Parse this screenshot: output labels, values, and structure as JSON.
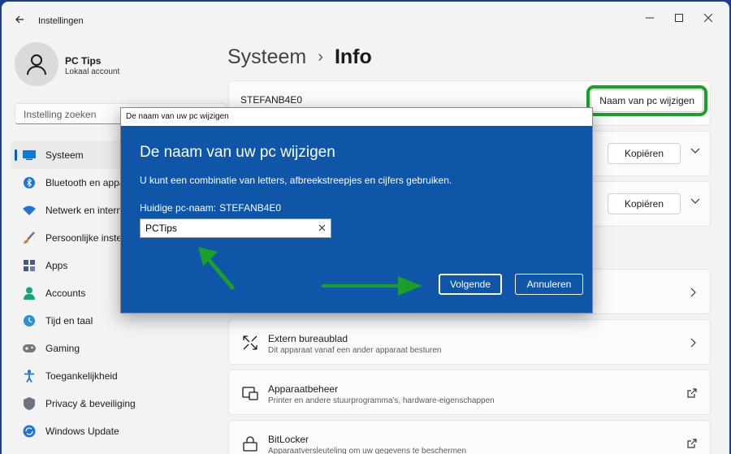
{
  "window": {
    "title": "Instellingen"
  },
  "profile": {
    "name": "PC Tips",
    "subtitle": "Lokaal account"
  },
  "search": {
    "placeholder": "Instelling zoeken"
  },
  "nav": [
    {
      "label": "Systeem",
      "icon": "monitor-icon",
      "active": true
    },
    {
      "label": "Bluetooth en appa",
      "icon": "bluetooth-icon"
    },
    {
      "label": "Netwerk en intern",
      "icon": "wifi-icon"
    },
    {
      "label": "Persoonlijke inste",
      "icon": "brush-icon"
    },
    {
      "label": "Apps",
      "icon": "apps-icon"
    },
    {
      "label": "Accounts",
      "icon": "person-icon"
    },
    {
      "label": "Tijd en taal",
      "icon": "globe-clock-icon"
    },
    {
      "label": "Gaming",
      "icon": "gamepad-icon"
    },
    {
      "label": "Toegankelijkheid",
      "icon": "accessibility-icon"
    },
    {
      "label": "Privacy & beveiliging",
      "icon": "shield-icon"
    },
    {
      "label": "Windows Update",
      "icon": "update-icon"
    }
  ],
  "breadcrumb": {
    "parent": "Systeem",
    "separator": "›",
    "current": "Info"
  },
  "device": {
    "name": "STEFANB4E0",
    "rename_label": "Naam van pc wijzigen"
  },
  "copy_label": "Kopiëren",
  "rows": [
    {
      "title": "Extern bureaublad",
      "subtitle": "Dit apparaat vanaf een ander apparaat besturen",
      "icon": "remote-desktop-icon",
      "action": "chevron"
    },
    {
      "title": "Apparaatbeheer",
      "subtitle": "Printer en andere stuurprogramma's, hardware-eigenschappen",
      "icon": "device-manager-icon",
      "action": "external"
    },
    {
      "title": "BitLocker",
      "subtitle": "Apparaatversleuteling om uw gegevens te beschermen",
      "icon": "bitlocker-icon",
      "action": "external"
    }
  ],
  "dialog": {
    "window_title": "De naam van uw pc wijzigen",
    "heading": "De naam van uw pc wijzigen",
    "description": "U kunt een combinatie van letters, afbreekstreepjes en cijfers gebruiken.",
    "current_label": "Huidige pc-naam:",
    "current_value": "STEFANB4E0",
    "input_value": "PCTips",
    "next_label": "Volgende",
    "cancel_label": "Annuleren"
  },
  "colors": {
    "accent": "#005fb8",
    "dialog_bg": "#0f56a8",
    "highlight": "#1b9f2a",
    "desktop": "#1a3f8c"
  }
}
